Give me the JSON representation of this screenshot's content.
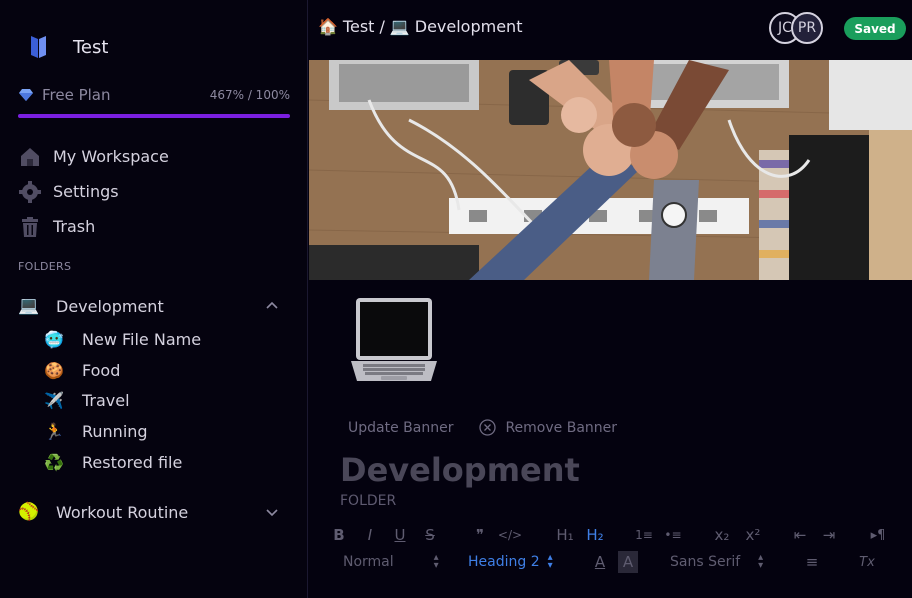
{
  "sidebar": {
    "workspace_name": "Test",
    "plan": {
      "name": "Free Plan",
      "usage": "467% / 100%",
      "usage_fraction": 1.0,
      "bar_color": "#7b1fe0"
    },
    "nav": [
      {
        "label": "My Workspace",
        "icon": "home-icon"
      },
      {
        "label": "Settings",
        "icon": "gear-icon"
      },
      {
        "label": "Trash",
        "icon": "trash-icon"
      }
    ],
    "folders_heading": "FOLDERS",
    "folders": [
      {
        "label": "Development",
        "emoji": "💻",
        "expanded": true,
        "files": [
          {
            "label": "New File Name",
            "emoji": "🥶"
          },
          {
            "label": "Food",
            "emoji": "🍪"
          },
          {
            "label": "Travel",
            "emoji": "✈️"
          },
          {
            "label": "Running",
            "emoji": "🏃"
          },
          {
            "label": "Restored file",
            "emoji": "♻️"
          }
        ]
      },
      {
        "label": "Workout Routine",
        "emoji": "🥎",
        "expanded": false,
        "files": []
      }
    ]
  },
  "header": {
    "breadcrumb": [
      {
        "emoji": "🏠",
        "label": "Test"
      },
      {
        "emoji": "💻",
        "label": "Development"
      }
    ],
    "separator": "/",
    "collaborators": [
      "JC",
      "PR"
    ],
    "status": "Saved",
    "status_color": "#1a9e5c"
  },
  "document": {
    "icon": "laptop-icon",
    "update_banner": "Update Banner",
    "remove_banner": "Remove Banner",
    "title": "Development",
    "subtitle": "FOLDER"
  },
  "toolbar": {
    "bold": "B",
    "italic": "I",
    "underline": "U",
    "strike": "S",
    "blockquote": "❞",
    "code": "</>",
    "h1": "H₁",
    "h2": "H₂",
    "ordered_list": "1≡",
    "bullet_list": "•≡",
    "subscript": "x₂",
    "superscript": "x²",
    "outdent": "⇤",
    "indent": "⇥",
    "rtl": "▸¶",
    "paragraph_style": "Normal",
    "heading_style": "Heading 2",
    "font_color": "A",
    "highlight": "A",
    "font_family": "Sans Serif",
    "align": "≡",
    "clear_format": "Tx"
  }
}
